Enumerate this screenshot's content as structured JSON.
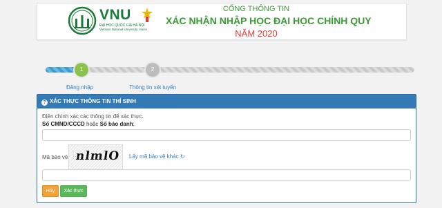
{
  "header": {
    "logo_text": "VNU",
    "university_vn": "ĐẠI HỌC QUỐC GIA HÀ NỘI",
    "university_en": "Vietnam National University, Hanoi",
    "title_line1": "CỔNG THÔNG TIN",
    "title_line2": "XÁC NHẬN NHẬP HỌC ĐẠI HỌC CHÍNH QUY",
    "title_line3": "NĂM 2020",
    "colors": {
      "green": "#3a9a35",
      "red": "#e53935"
    }
  },
  "steps": {
    "progress": 0.1,
    "items": [
      {
        "number": "1",
        "label": "Đăng nhập",
        "active": true
      },
      {
        "number": "2",
        "label": "Thông tin xét tuyển",
        "active": false
      }
    ]
  },
  "panel": {
    "title": "XÁC THỰC THÔNG TIN THÍ SINH",
    "instruction": "Điền chính xác các thông tin để xác thực.",
    "id_label_1": "Số CMND/CCCD",
    "id_label_or": "hoặc",
    "id_label_2": "Số báo danh",
    "id_colon": ":",
    "id_value": "",
    "captcha_label": "Mã bảo vệ:",
    "captcha_text": "nlmlO",
    "refresh_label": "Lấy mã bảo vệ khác",
    "captcha_value": "",
    "cancel_label": "Hủy",
    "submit_label": "Xác thực",
    "colors": {
      "header": "#337ab7",
      "cancel": "#f0a43a",
      "submit": "#5cb85c"
    }
  }
}
